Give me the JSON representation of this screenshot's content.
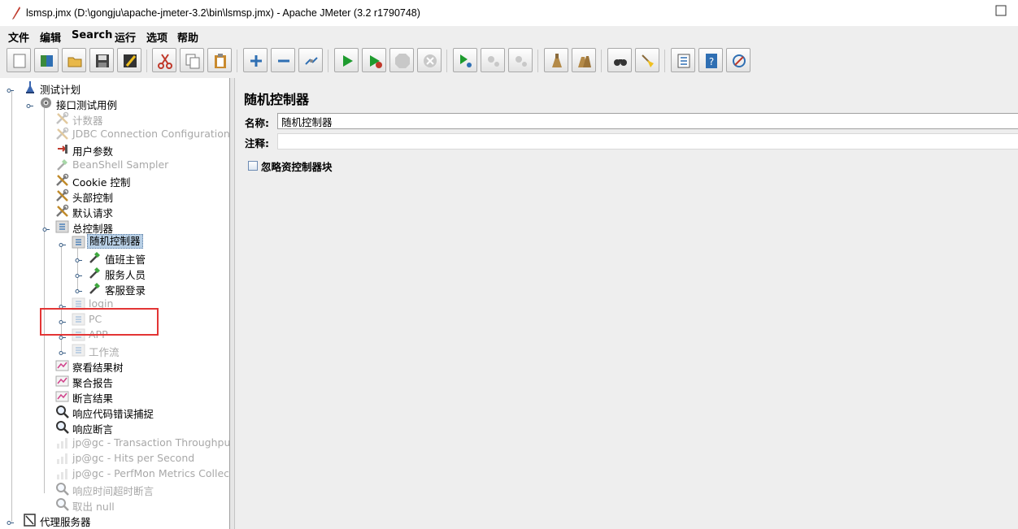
{
  "window": {
    "title": "lsmsp.jmx (D:\\gongju\\apache-jmeter-3.2\\bin\\lsmsp.jmx) - Apache JMeter (3.2 r1790748)"
  },
  "menu": [
    "文件",
    "编辑",
    "Search",
    "运行",
    "选项",
    "帮助"
  ],
  "toolbar": {
    "buttons": [
      "new-icon",
      "templates-icon",
      "open-icon",
      "save-icon",
      "save-as-icon",
      "cut-icon",
      "copy-icon",
      "paste-icon",
      "expand-icon",
      "collapse-icon",
      "toggle-icon",
      "start-icon",
      "start-no-pause-icon",
      "stop-icon",
      "shutdown-icon",
      "remote-start-icon",
      "remote-stop-icon",
      "remote-shutdown-icon",
      "clear-icon",
      "clear-all-icon",
      "search-icon",
      "reset-search-icon",
      "function-helper-icon",
      "help-icon",
      "log-icon"
    ]
  },
  "tree": {
    "nodes": [
      {
        "label": "测试计划",
        "disabled": false,
        "icon": "test-plan-icon"
      },
      {
        "label": "接口测试用例",
        "disabled": false,
        "icon": "thread-group-icon"
      },
      {
        "label": "计数器",
        "disabled": true,
        "icon": "config-element-icon"
      },
      {
        "label": "JDBC Connection Configuration",
        "disabled": true,
        "icon": "config-element-icon"
      },
      {
        "label": "用户参数",
        "disabled": false,
        "icon": "pre-processor-icon"
      },
      {
        "label": "BeanShell Sampler",
        "disabled": true,
        "icon": "sampler-icon"
      },
      {
        "label": "Cookie 控制",
        "disabled": false,
        "icon": "config-element-icon"
      },
      {
        "label": "头部控制",
        "disabled": false,
        "icon": "config-element-icon"
      },
      {
        "label": "默认请求",
        "disabled": false,
        "icon": "config-element-icon"
      },
      {
        "label": "总控制器",
        "disabled": false,
        "icon": "controller-icon"
      },
      {
        "label": "随机控制器",
        "disabled": false,
        "icon": "controller-icon",
        "selected": true
      },
      {
        "label": "值班主管",
        "disabled": false,
        "icon": "sampler-icon"
      },
      {
        "label": "服务人员",
        "disabled": false,
        "icon": "sampler-icon"
      },
      {
        "label": "客服登录",
        "disabled": false,
        "icon": "sampler-icon"
      },
      {
        "label": "login",
        "disabled": true,
        "icon": "controller-icon"
      },
      {
        "label": "PC",
        "disabled": true,
        "icon": "controller-icon"
      },
      {
        "label": "APP",
        "disabled": true,
        "icon": "controller-icon"
      },
      {
        "label": "工作流",
        "disabled": true,
        "icon": "controller-icon"
      },
      {
        "label": "察看结果树",
        "disabled": false,
        "icon": "listener-icon"
      },
      {
        "label": "聚合报告",
        "disabled": false,
        "icon": "listener-icon"
      },
      {
        "label": "断言结果",
        "disabled": false,
        "icon": "listener-icon"
      },
      {
        "label": "响应代码错误捕捉",
        "disabled": false,
        "icon": "assertion-icon"
      },
      {
        "label": "响应断言",
        "disabled": false,
        "icon": "assertion-icon"
      },
      {
        "label": "jp@gc - Transaction Throughput vs",
        "disabled": true,
        "icon": "graph-icon"
      },
      {
        "label": "jp@gc - Hits per Second",
        "disabled": true,
        "icon": "graph-icon"
      },
      {
        "label": "jp@gc - PerfMon Metrics Collector",
        "disabled": true,
        "icon": "graph-icon"
      },
      {
        "label": "响应时间超时断言",
        "disabled": true,
        "icon": "assertion-icon"
      },
      {
        "label": "取出 null",
        "disabled": true,
        "icon": "assertion-icon"
      },
      {
        "label": "代理服务器",
        "disabled": false,
        "icon": "proxy-icon"
      }
    ]
  },
  "panel": {
    "title": "随机控制器",
    "name_label": "名称:",
    "name_value": "随机控制器",
    "comment_label": "注释:",
    "comment_value": "",
    "checkbox_label": "忽略资控制器块",
    "checkbox_checked": false
  }
}
